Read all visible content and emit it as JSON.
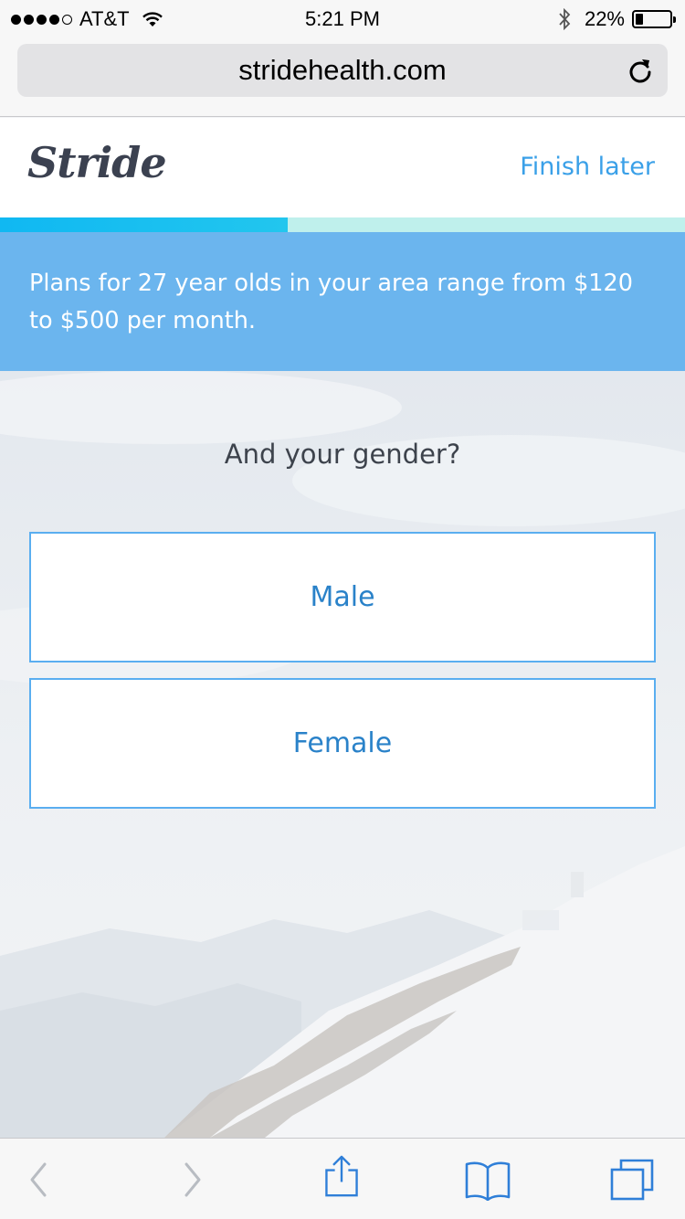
{
  "status_bar": {
    "carrier": "AT&T",
    "time": "5:21 PM",
    "battery_percent": "22%",
    "battery_level": 0.22,
    "signal_bars_filled": 4,
    "signal_bars_total": 5
  },
  "browser": {
    "url": "stridehealth.com"
  },
  "header": {
    "logo_text": "Stride",
    "finish_later_label": "Finish later"
  },
  "progress": {
    "fraction": 0.42
  },
  "banner": {
    "message": "Plans for 27 year olds in your area range from $120 to $500 per month."
  },
  "question": {
    "text": "And your gender?",
    "options": [
      {
        "label": "Male"
      },
      {
        "label": "Female"
      }
    ]
  },
  "toolbar": {
    "icons": [
      "back-icon",
      "forward-icon",
      "share-icon",
      "bookmarks-icon",
      "tabs-icon"
    ]
  },
  "colors": {
    "accent": "#3aa0e8",
    "banner": "#6bb5ee",
    "progress_fill": "#10b8f2",
    "progress_track": "#bff0ec",
    "ios_blue": "#2f7fd8"
  }
}
